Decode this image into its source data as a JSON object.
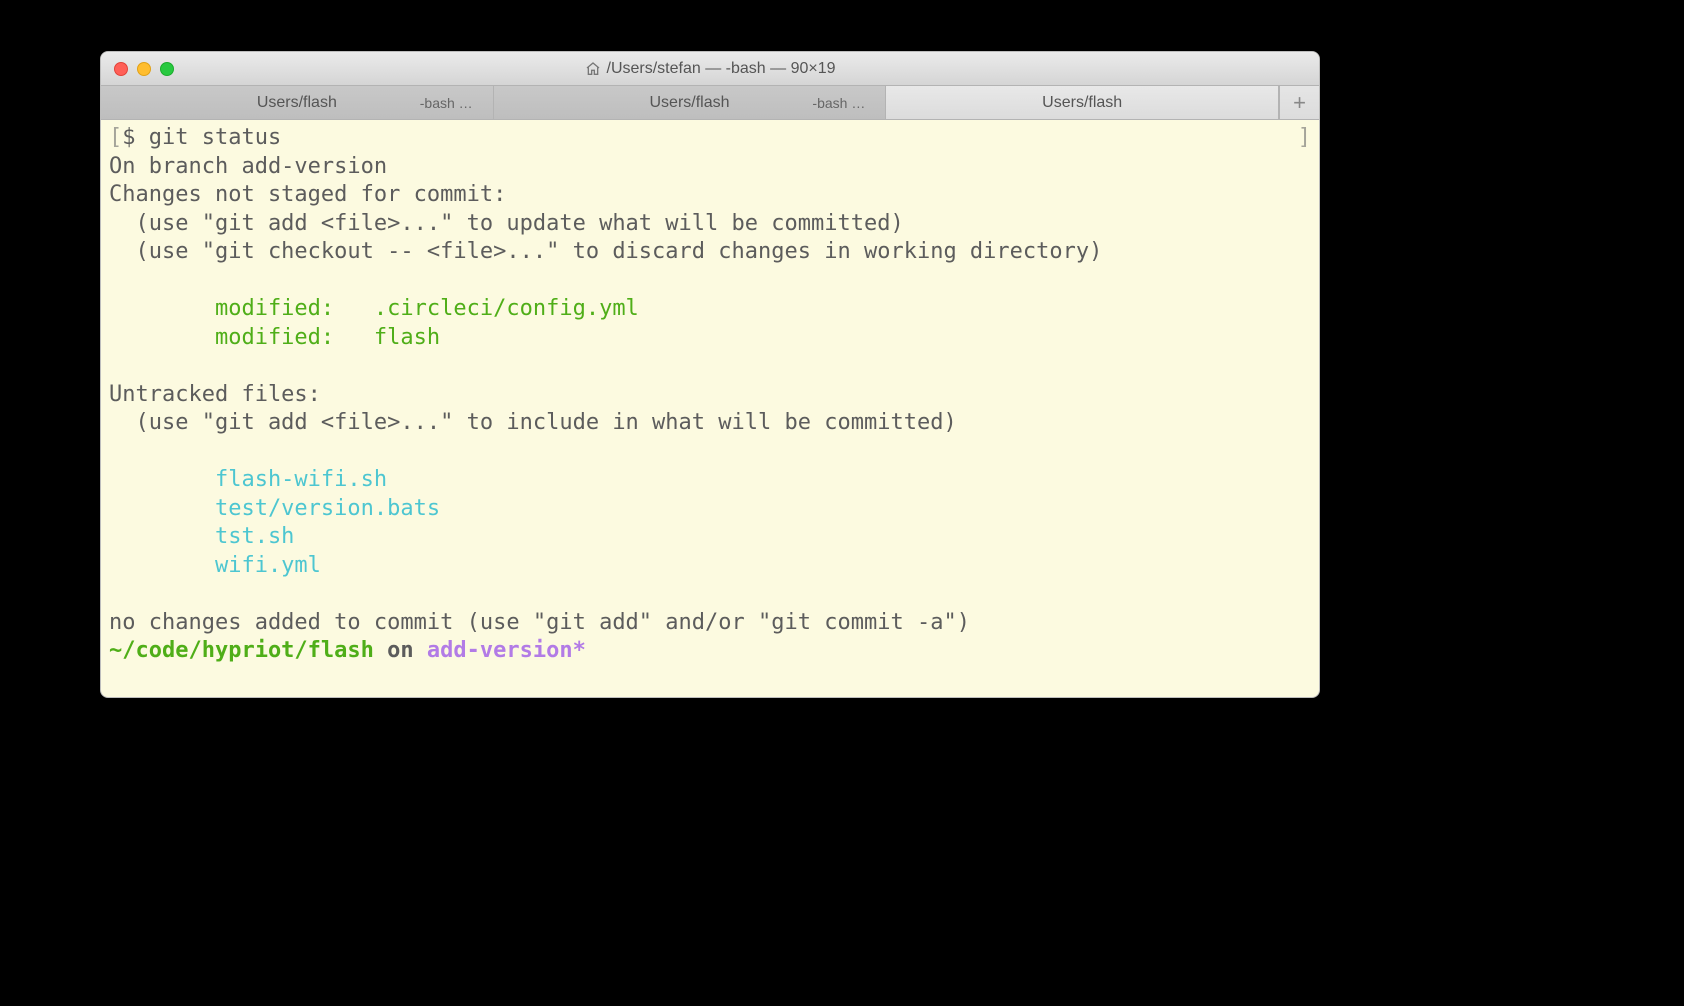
{
  "window": {
    "title": "/Users/stefan — -bash — 90×19"
  },
  "tabs": [
    {
      "label": "Users/flash",
      "sub": "-bash …",
      "active": false
    },
    {
      "label": "Users/flash",
      "sub": "-bash …",
      "active": false
    },
    {
      "label": "Users/flash",
      "sub": "",
      "active": true
    }
  ],
  "terminal": {
    "prompt_symbol": "$ ",
    "command": "git status",
    "line_branch": "On branch add-version",
    "line_changes_hdr": "Changes not staged for commit:",
    "line_hint_add": "  (use \"git add <file>...\" to update what will be committed)",
    "line_hint_checkout": "  (use \"git checkout -- <file>...\" to discard changes in working directory)",
    "modified": [
      "        modified:   .circleci/config.yml",
      "        modified:   flash"
    ],
    "line_untracked_hdr": "Untracked files:",
    "line_hint_untracked": "  (use \"git add <file>...\" to include in what will be committed)",
    "untracked": [
      "        flash-wifi.sh",
      "        test/version.bats",
      "        tst.sh",
      "        wifi.yml"
    ],
    "line_no_changes": "no changes added to commit (use \"git add\" and/or \"git commit -a\")",
    "prompt_path": "~/code/hypriot/flash",
    "prompt_on": " on ",
    "prompt_branch": "add-version*"
  }
}
